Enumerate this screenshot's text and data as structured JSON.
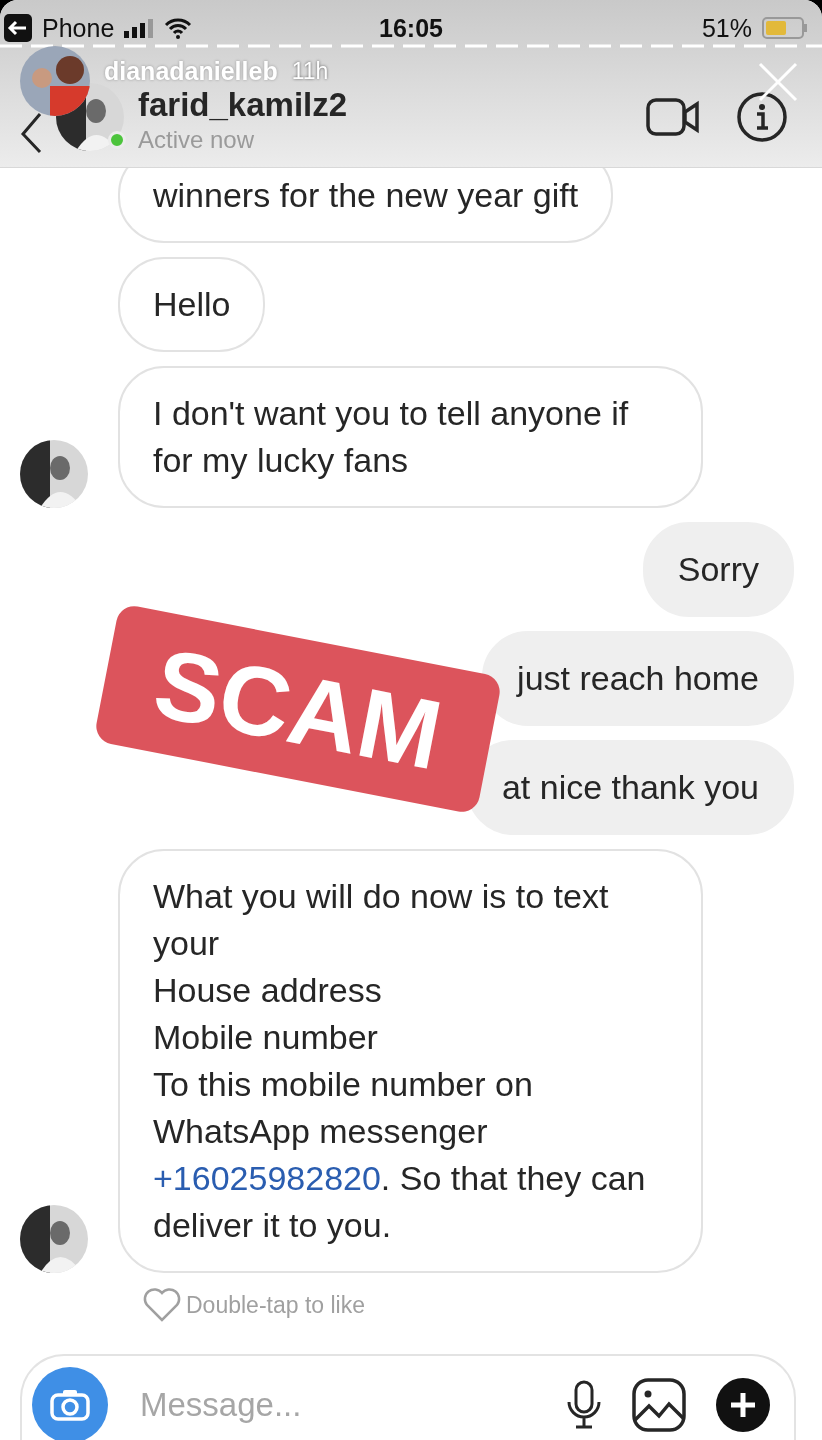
{
  "status_bar": {
    "back_label": "Phone",
    "time": "16:05",
    "battery": "51%"
  },
  "story": {
    "username": "dianadanielleb",
    "age": "11h"
  },
  "chat_header": {
    "username": "farid_kamilz2",
    "status": "Active now",
    "online": true
  },
  "messages": [
    {
      "kind": "received",
      "text": "winners for the new year gift",
      "show_avatar": false
    },
    {
      "kind": "received",
      "text": "Hello",
      "show_avatar": false
    },
    {
      "kind": "received",
      "text": "I don't want you to tell anyone if for my lucky fans",
      "show_avatar": true
    },
    {
      "kind": "sent",
      "text": "Sorry"
    },
    {
      "kind": "sent",
      "text": "just reach home"
    },
    {
      "kind": "sent",
      "text": "at nice thank you"
    },
    {
      "kind": "received",
      "text": "What you will do now is to text your\nHouse address\nMobile number\nTo this mobile number on WhatsApp messenger\n",
      "link": "+16025982820",
      "after": ".  So that they can deliver it to you.",
      "show_avatar": true
    }
  ],
  "sticker": {
    "text": "SCAM"
  },
  "like_hint": "Double-tap to like",
  "composer": {
    "placeholder": "Message..."
  }
}
